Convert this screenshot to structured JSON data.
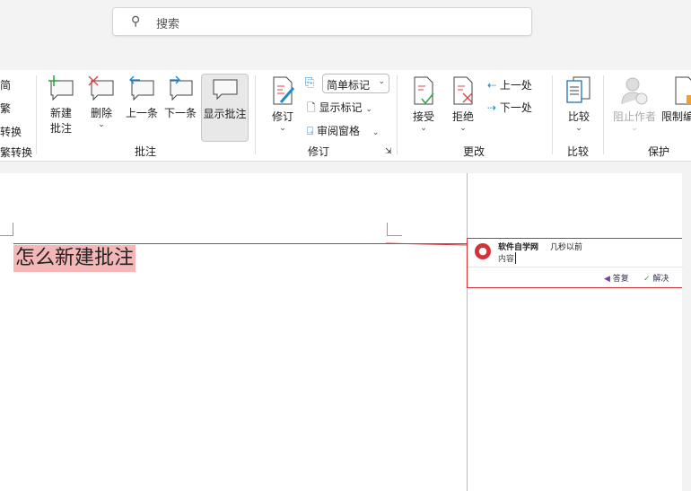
{
  "search": {
    "placeholder": "搜索"
  },
  "ribbon": {
    "left_partial": [
      "简",
      "繁",
      "转换",
      "繁转换"
    ],
    "comments_group": {
      "label": "批注",
      "new": "新建批注",
      "new_l1": "新建",
      "new_l2": "批注",
      "delete": "删除",
      "previous": "上一条",
      "next": "下一条",
      "show": "显示批注"
    },
    "tracking_group": {
      "label": "修订",
      "track": "修订",
      "markup_select": "简单标记",
      "show_markup": "显示标记",
      "reviewing_pane": "审阅窗格"
    },
    "changes_group": {
      "label": "更改",
      "accept": "接受",
      "reject": "拒绝",
      "previous": "上一处",
      "next": "下一处"
    },
    "compare_group": {
      "label": "比较",
      "compare": "比较"
    },
    "protect_group": {
      "label": "保护",
      "block_authors": "阻止作者",
      "restrict": "限制编"
    }
  },
  "document": {
    "text": "怎么新建批注"
  },
  "comment": {
    "author": "软件自学网",
    "time": "几秒以前",
    "body": "内容",
    "reply": "答复",
    "resolve": "解决"
  },
  "colors": {
    "accent": "#d13438",
    "highlight": "#f4b6b6"
  }
}
